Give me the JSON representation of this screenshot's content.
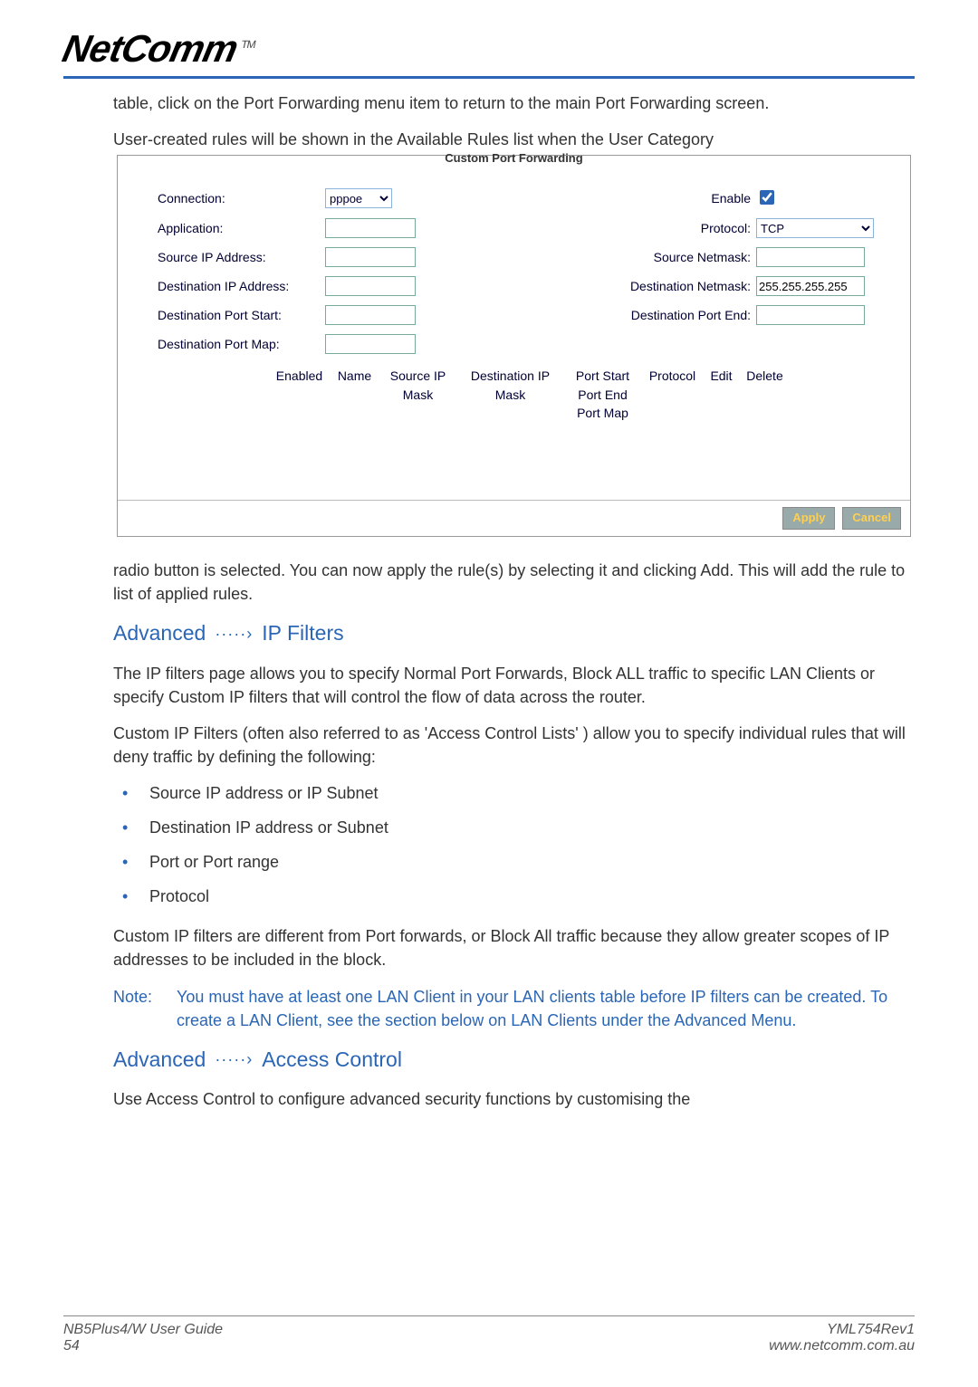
{
  "logo": {
    "text": "NetComm",
    "tm": "TM"
  },
  "intro1": "table, click on the Port Forwarding menu item to return to the main Port Forwarding screen.",
  "intro2": "User-created rules will be shown in the Available Rules list when the User Category",
  "screenshot": {
    "title": "Custom Port Forwarding",
    "labels": {
      "connection": "Connection:",
      "application": "Application:",
      "src_ip": "Source IP Address:",
      "dst_ip": "Destination IP Address:",
      "dst_port_start": "Destination Port Start:",
      "dst_port_map": "Destination Port Map:",
      "enable": "Enable",
      "protocol": "Protocol:",
      "src_netmask": "Source Netmask:",
      "dst_netmask": "Destination Netmask:",
      "dst_port_end": "Destination Port End:"
    },
    "values": {
      "connection": "pppoe",
      "protocol": "TCP",
      "dst_netmask": "255.255.255.255"
    },
    "table_headers": {
      "enabled": "Enabled",
      "name": "Name",
      "src": "Source IP Mask",
      "dst": "Destination IP Mask",
      "port": "Port Start Port End Port Map",
      "protocol": "Protocol",
      "edit": "Edit",
      "delete": "Delete"
    },
    "buttons": {
      "apply": "Apply",
      "cancel": "Cancel"
    }
  },
  "after_shot": "radio button is selected. You can now apply the rule(s) by selecting it and clicking Add. This will add the rule to list of applied rules.",
  "section_ip": {
    "prefix": "Advanced",
    "arrow": "·····›",
    "title": "IP Filters"
  },
  "ip_p1": "The IP filters page allows you to specify Normal Port Forwards,  Block ALL traffic to specific LAN Clients or specify Custom IP filters that will control the flow of data across the router.",
  "ip_p2": "Custom IP Filters (often also referred to as 'Access Control Lists' ) allow you to specify individual rules that will deny traffic by defining the following:",
  "bullets": [
    "Source IP address or IP Subnet",
    "Destination IP address or Subnet",
    "Port or Port range",
    "Protocol"
  ],
  "ip_p3": "Custom IP filters are different from Port forwards, or Block All traffic because they allow greater scopes of IP addresses to be included in the block.",
  "note": {
    "label": "Note:",
    "text": "You must have at least one LAN Client in your LAN clients table before IP filters can be created. To create a LAN Client, see the section below on LAN Clients under the Advanced Menu."
  },
  "section_ac": {
    "prefix": "Advanced",
    "arrow": "·····›",
    "title": "Access Control"
  },
  "ac_p1": "Use Access Control to configure advanced security functions by customising the",
  "footer": {
    "left1": "NB5Plus4/W User Guide",
    "left2": "54",
    "right1": "YML754Rev1",
    "right2": "www.netcomm.com.au"
  }
}
